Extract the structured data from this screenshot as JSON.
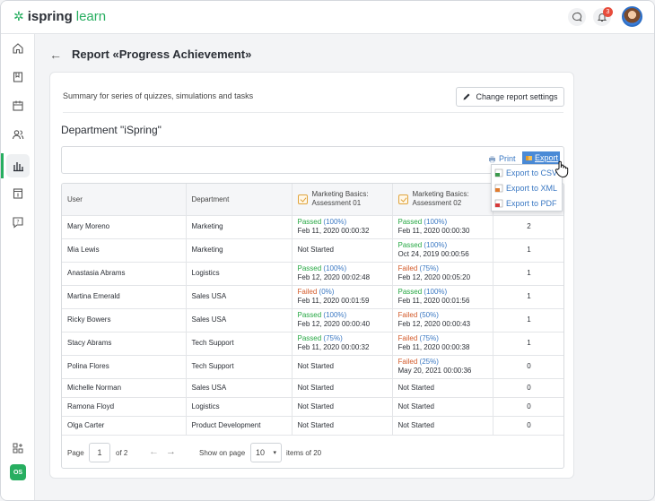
{
  "app": {
    "logo_part1": "ispring",
    "logo_part2": "learn",
    "notification_count": "3",
    "user_initials": "OS"
  },
  "page": {
    "title": "Report «Progress Achievement»"
  },
  "card": {
    "summary": "Summary for series of quizzes, simulations and tasks",
    "settings_button": "Change report settings",
    "department": "Department \"iSpring\"",
    "print_label": "Print",
    "export_label": "Export",
    "export_menu": [
      "Export to CSV",
      "Export to XML",
      "Export to PDF"
    ]
  },
  "table": {
    "columns": [
      "User",
      "Department",
      "Marketing Basics:",
      "Assessment 01",
      "Marketing Basics:",
      "Assessment 02",
      ""
    ],
    "rows": [
      {
        "user": "Mary Moreno",
        "dept": "Marketing",
        "a1_status": "Passed",
        "a1_pct": "(100%)",
        "a1_date": "Feb 11, 2020 00:00:32",
        "a2_status": "Passed",
        "a2_pct": "(100%)",
        "a2_date": "Feb 11, 2020 00:00:30",
        "count": "2"
      },
      {
        "user": "Mia Lewis",
        "dept": "Marketing",
        "a1_status": "Not Started",
        "a1_pct": "",
        "a1_date": "",
        "a2_status": "Passed",
        "a2_pct": "(100%)",
        "a2_date": "Oct 24, 2019 00:00:56",
        "count": "1"
      },
      {
        "user": "Anastasia Abrams",
        "dept": "Logistics",
        "a1_status": "Passed",
        "a1_pct": "(100%)",
        "a1_date": "Feb 12, 2020 00:02:48",
        "a2_status": "Failed",
        "a2_pct": "(75%)",
        "a2_date": "Feb 12, 2020 00:05:20",
        "count": "1"
      },
      {
        "user": "Martina Emerald",
        "dept": "Sales USA",
        "a1_status": "Failed",
        "a1_pct": "(0%)",
        "a1_date": "Feb 11, 2020 00:01:59",
        "a2_status": "Passed",
        "a2_pct": "(100%)",
        "a2_date": "Feb 11, 2020 00:01:56",
        "count": "1"
      },
      {
        "user": "Ricky Bowers",
        "dept": "Sales USA",
        "a1_status": "Passed",
        "a1_pct": "(100%)",
        "a1_date": "Feb 12, 2020 00:00:40",
        "a2_status": "Failed",
        "a2_pct": "(50%)",
        "a2_date": "Feb 12, 2020 00:00:43",
        "count": "1"
      },
      {
        "user": "Stacy Abrams",
        "dept": "Tech Support",
        "a1_status": "Passed",
        "a1_pct": "(75%)",
        "a1_date": "Feb 11, 2020 00:00:32",
        "a2_status": "Failed",
        "a2_pct": "(75%)",
        "a2_date": "Feb 11, 2020 00:00:38",
        "count": "1"
      },
      {
        "user": "Polina Flores",
        "dept": "Tech Support",
        "a1_status": "Not Started",
        "a1_pct": "",
        "a1_date": "",
        "a2_status": "Failed",
        "a2_pct": "(25%)",
        "a2_date": "May 20, 2021 00:00:36",
        "count": "0"
      },
      {
        "user": "Michelle Norman",
        "dept": "Sales USA",
        "a1_status": "Not Started",
        "a1_pct": "",
        "a1_date": "",
        "a2_status": "Not Started",
        "a2_pct": "",
        "a2_date": "",
        "count": "0"
      },
      {
        "user": "Ramona Floyd",
        "dept": "Logistics",
        "a1_status": "Not Started",
        "a1_pct": "",
        "a1_date": "",
        "a2_status": "Not Started",
        "a2_pct": "",
        "a2_date": "",
        "count": "0"
      },
      {
        "user": "Olga Carter",
        "dept": "Product Development",
        "a1_status": "Not Started",
        "a1_pct": "",
        "a1_date": "",
        "a2_status": "Not Started",
        "a2_pct": "",
        "a2_date": "",
        "count": "0"
      }
    ]
  },
  "pager": {
    "page_label": "Page",
    "page_value": "1",
    "of_label": "of 2",
    "show_label": "Show on page",
    "per_page": "10",
    "items_label": "items of 20"
  },
  "colors": {
    "accent": "#27ae60",
    "link": "#3a78c3",
    "passed": "#27a844",
    "failed": "#d35b2b"
  }
}
